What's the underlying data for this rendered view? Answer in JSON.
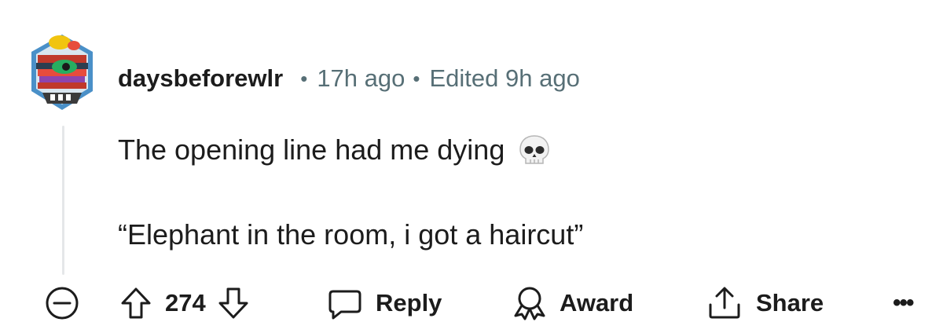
{
  "comment": {
    "username": "daysbeforewlr",
    "separator": "•",
    "time_ago": "17h ago",
    "edited": "Edited 9h ago",
    "body": {
      "line1": "The opening line had me dying",
      "line1_emoji": "skull-emoji",
      "line2": "“Elephant in the room, i got a haircut”"
    }
  },
  "actions": {
    "vote_count": "274",
    "reply_label": "Reply",
    "award_label": "Award",
    "share_label": "Share",
    "more_label": "•••"
  },
  "colors": {
    "text": "#1c1c1c",
    "muted": "#576f76",
    "thread_line": "#e5e7e9",
    "background": "#ffffff"
  }
}
